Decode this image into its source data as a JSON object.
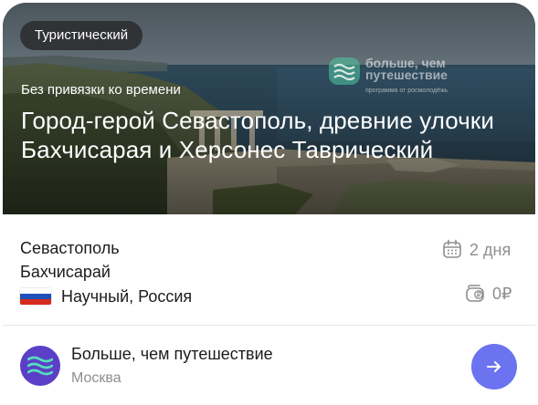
{
  "hero": {
    "category_tag": "Туристический",
    "subtitle": "Без привязки ко времени",
    "title": "Город-герой Севастополь, древние улочки Бахчисарая и Херсонес Таврический",
    "watermark": {
      "name": "больше, чем путешествие",
      "tagline": "программа от росмолодёжь"
    }
  },
  "route": {
    "cities": [
      "Севастополь",
      "Бахчисарай"
    ],
    "flag_icon": "russia-flag-icon",
    "organizer_type_country": "Научный, Россия"
  },
  "meta": {
    "duration_icon": "calendar-icon",
    "duration": "2 дня",
    "price_icon": "ruble-wallet-icon",
    "price": "0₽"
  },
  "organizer": {
    "avatar_icon": "waves-logo-icon",
    "name": "Больше, чем путешествие",
    "city": "Москва",
    "open_icon": "arrow-right-icon"
  },
  "colors": {
    "accent_button": "#6b73f0",
    "organizer_avatar": "#5b3fc7",
    "muted_text": "#8e8e93"
  }
}
